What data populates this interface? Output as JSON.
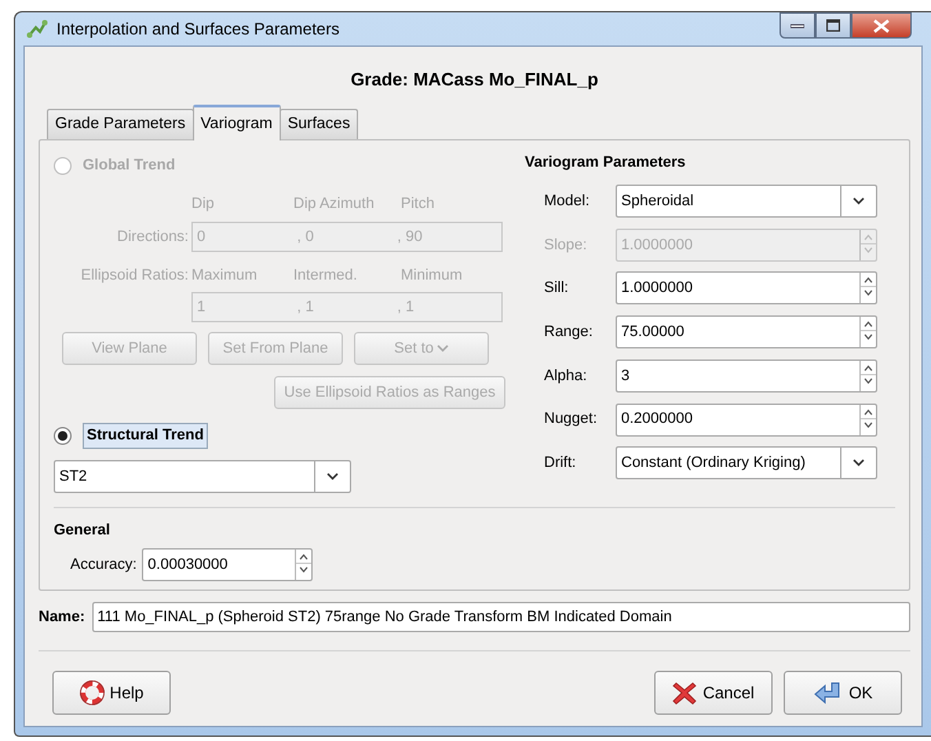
{
  "window": {
    "title": "Interpolation and Surfaces Parameters"
  },
  "heading": "Grade: MACass Mo_FINAL_p",
  "tabs": [
    {
      "label": "Grade Parameters",
      "selected": false
    },
    {
      "label": "Variogram",
      "selected": true
    },
    {
      "label": "Surfaces",
      "selected": false
    }
  ],
  "global_trend": {
    "label": "Global Trend",
    "selected": false,
    "disabled": true,
    "direction_headers": [
      "Dip",
      "Dip Azimuth",
      "Pitch"
    ],
    "directions": {
      "label": "Directions:",
      "values": [
        "0",
        ", 0",
        ", 90"
      ]
    },
    "ellipsoid_ratios": {
      "label": "Ellipsoid Ratios:",
      "headers": [
        "Maximum",
        "Intermed.",
        "Minimum"
      ],
      "values": [
        "1",
        ", 1",
        ", 1"
      ]
    },
    "buttons": [
      {
        "label": "View Plane",
        "kind": "plain"
      },
      {
        "label": "Set From Plane",
        "kind": "plain"
      },
      {
        "label": "Set to",
        "kind": "menu"
      },
      {
        "label": "Use Ellipsoid Ratios as Ranges",
        "kind": "wide"
      }
    ]
  },
  "structural_trend": {
    "label": "Structural Trend",
    "selected": true,
    "value": "ST2"
  },
  "variogram_parameters": {
    "title": "Variogram Parameters",
    "fields": [
      {
        "label": "Model:",
        "value": "Spheroidal",
        "kind": "combo",
        "disabled": false
      },
      {
        "label": "Slope:",
        "value": "1.0000000",
        "kind": "spin",
        "disabled": true
      },
      {
        "label": "Sill:",
        "value": "1.0000000",
        "kind": "spin",
        "disabled": false
      },
      {
        "label": "Range:",
        "value": "75.00000",
        "kind": "spin",
        "disabled": false
      },
      {
        "label": "Alpha:",
        "value": "3",
        "kind": "spin",
        "disabled": false
      },
      {
        "label": "Nugget:",
        "value": "0.2000000",
        "kind": "spin",
        "disabled": false
      },
      {
        "label": "Drift:",
        "value": "Constant (Ordinary Kriging)",
        "kind": "combo",
        "disabled": false
      }
    ]
  },
  "general": {
    "title": "General",
    "accuracy": {
      "label": "Accuracy:",
      "value": "0.00030000"
    }
  },
  "name": {
    "label": "Name:",
    "value": "111 Mo_FINAL_p (Spheroid ST2) 75range No Grade Transform BM Indicated Domain"
  },
  "buttons": [
    {
      "label": "Help",
      "kind": "help"
    },
    {
      "label": "Cancel",
      "kind": "cancel"
    },
    {
      "label": "OK",
      "kind": "ok"
    }
  ]
}
